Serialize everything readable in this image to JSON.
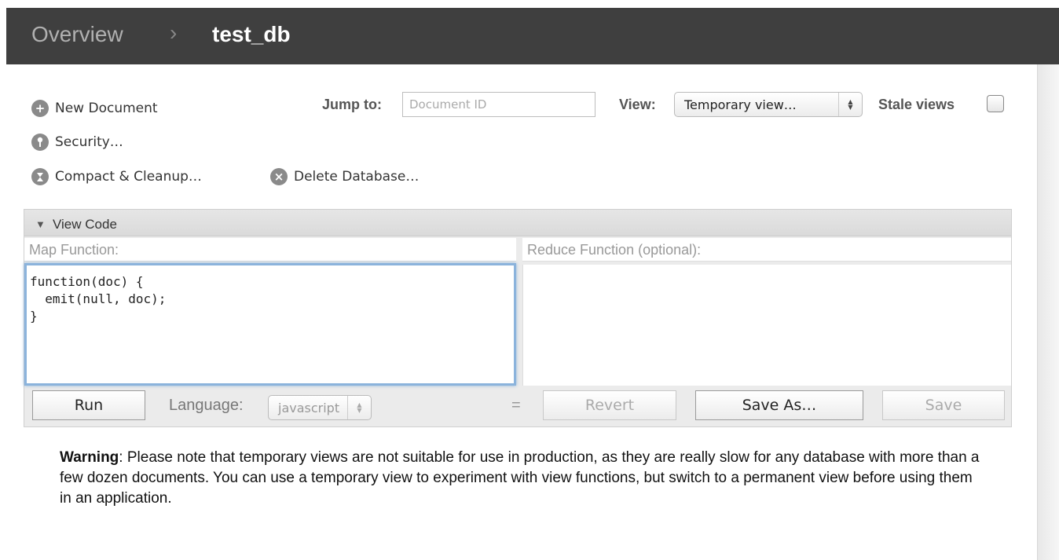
{
  "breadcrumb": {
    "overview": "Overview",
    "separator": "›",
    "current": "test_db"
  },
  "actions": {
    "new_document": "New Document",
    "security": "Security…",
    "compact_cleanup": "Compact & Cleanup…",
    "delete_database": "Delete Database…"
  },
  "jump": {
    "label": "Jump to:",
    "placeholder": "Document ID"
  },
  "view": {
    "label": "View:",
    "selected": "Temporary view…"
  },
  "stale": {
    "label": "Stale views",
    "checked": false
  },
  "code_panel": {
    "title": "View Code",
    "map_label": "Map Function:",
    "reduce_label": "Reduce Function (optional):",
    "map_code": "function(doc) {\n  emit(null, doc);\n}",
    "reduce_code": ""
  },
  "toolbar": {
    "run": "Run",
    "language_label": "Language:",
    "language_value": "javascript",
    "equals": "=",
    "revert": "Revert",
    "save_as": "Save As…",
    "save": "Save"
  },
  "warning": {
    "heading": "Warning",
    "text": ": Please note that temporary views are not suitable for use in production, as they are really slow for any database with more than a few dozen documents. You can use a temporary view to experiment with view functions, but switch to a permanent view before using them in an application."
  },
  "icons": {
    "new_document": "plus-circle-icon",
    "security": "key-circle-icon",
    "compact": "hourglass-circle-icon",
    "delete": "x-circle-icon"
  },
  "colors": {
    "header_bg": "#3f3f3f",
    "focus_ring": "#8bb3dc"
  }
}
